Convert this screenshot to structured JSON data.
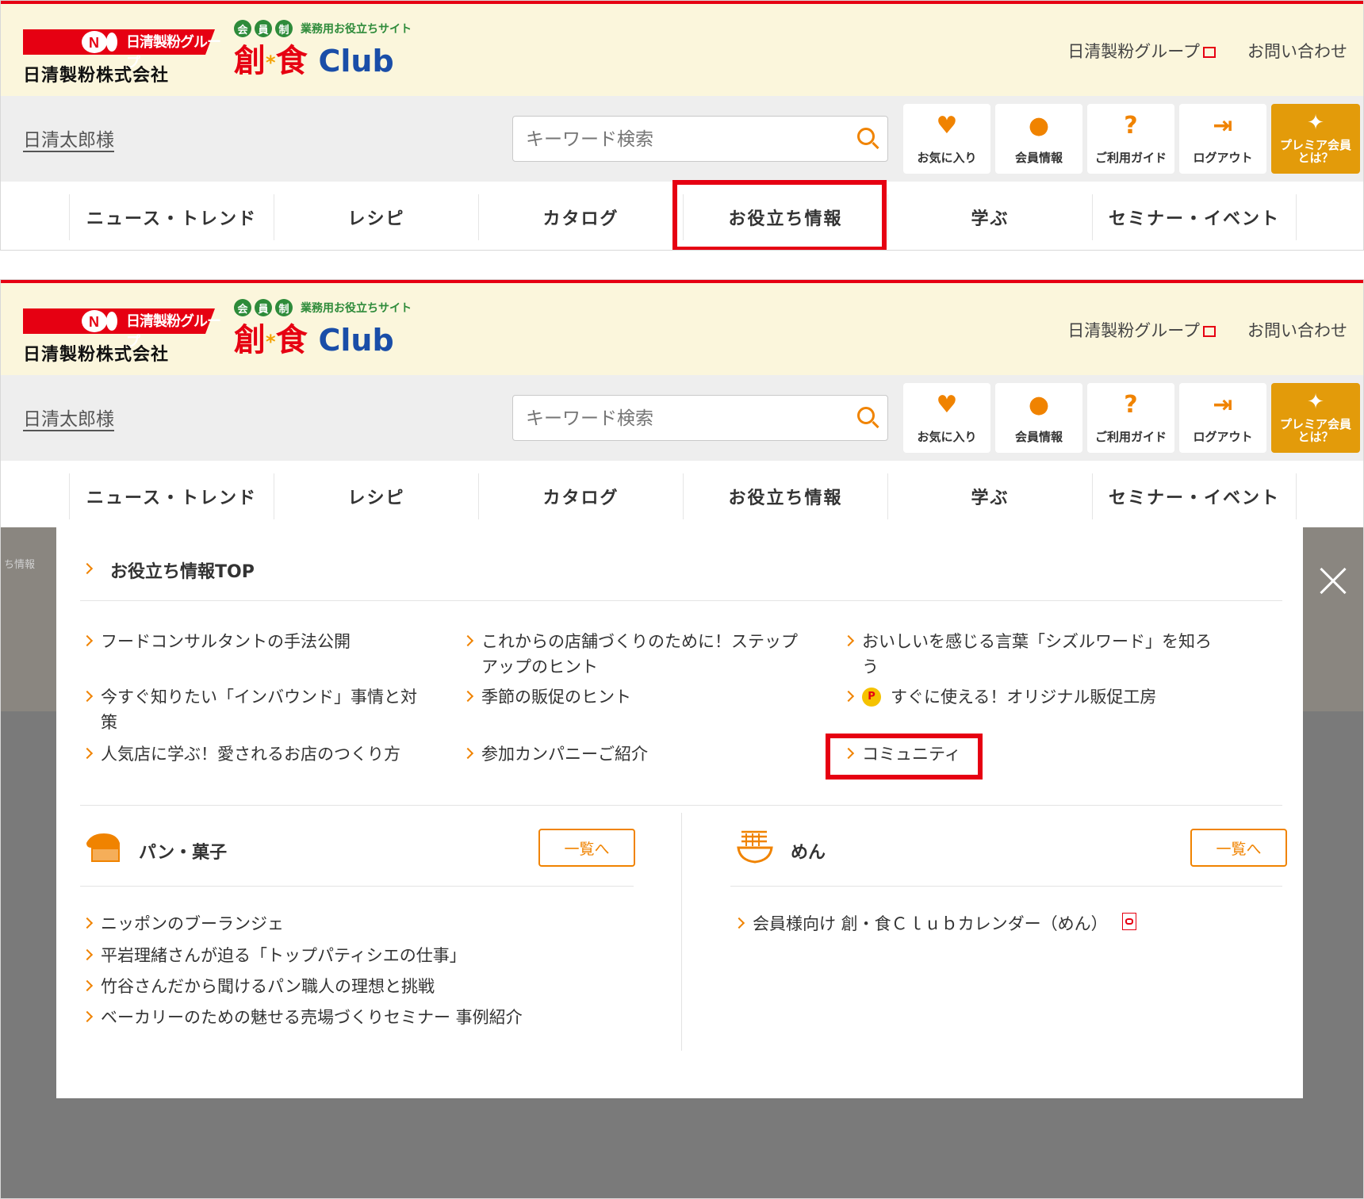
{
  "header": {
    "brand_group_tag": "日清製粉グループ",
    "company_name": "日清製粉株式会社",
    "site_badges": [
      "会",
      "員",
      "制"
    ],
    "site_subtitle": "業務用お役立ちサイト",
    "site_name_kanji_1": "創",
    "site_name_dot": "*",
    "site_name_kanji_2": "食",
    "site_name_club": "Club",
    "links": [
      {
        "label": "日清製粉グループ",
        "icon": "external-link-icon"
      },
      {
        "label": "お問い合わせ"
      }
    ]
  },
  "account": {
    "username": "日清太郎様",
    "search_placeholder": "キーワード検索",
    "buttons": [
      {
        "label": "お気に入り",
        "icon": "heart-icon",
        "glyph": "♥"
      },
      {
        "label": "会員情報",
        "icon": "person-icon",
        "glyph": "●"
      },
      {
        "label": "ご利用ガイド",
        "icon": "question-icon",
        "glyph": "?"
      },
      {
        "label": "ログアウト",
        "icon": "logout-icon",
        "glyph": "⇥"
      }
    ],
    "premium": {
      "line1": "プレミア会員",
      "line2": "とは？",
      "icon": "sparkle-icon",
      "glyph": "✦"
    }
  },
  "nav": {
    "items": [
      "ニュース・トレンド",
      "レシピ",
      "カタログ",
      "お役立ち情報",
      "学ぶ",
      "セミナー・イベント"
    ]
  },
  "background_crumb": "ち情報",
  "dropdown": {
    "top_link": "お役立ち情報TOP",
    "links": [
      "フードコンサルタントの手法公開",
      "これからの店舗づくりのために！ステップアップのヒント",
      "おいしいを感じる言葉「シズルワード」を知ろう",
      "今すぐ知りたい「インバウンド」事情と対策",
      "季節の販促のヒント",
      "すぐに使える！オリジナル販促工房",
      "人気店に学ぶ！愛されるお店のつくり方",
      "参加カンパニーご紹介",
      "コミュニティ"
    ],
    "p_badge": "P",
    "categories": [
      {
        "title": "パン・菓子",
        "button": "一覧へ",
        "icon": "bread-icon",
        "links": [
          "ニッポンのブーランジェ",
          "平岩理緒さんが迫る「トップパティシエの仕事」",
          "竹谷さんだから聞けるパン職人の理想と挑戦",
          "ベーカリーのための魅せる売場づくりセミナー 事例紹介"
        ]
      },
      {
        "title": "めん",
        "button": "一覧へ",
        "icon": "noodle-bowl-icon",
        "links": [
          "会員様向け 創・食Ｃｌｕｂカレンダー（めん）"
        ]
      }
    ]
  },
  "colors": {
    "accent": "#f08300",
    "brand_red": "#e60012",
    "premium": "#e39b0a",
    "header_bg": "#fbf6dc"
  }
}
